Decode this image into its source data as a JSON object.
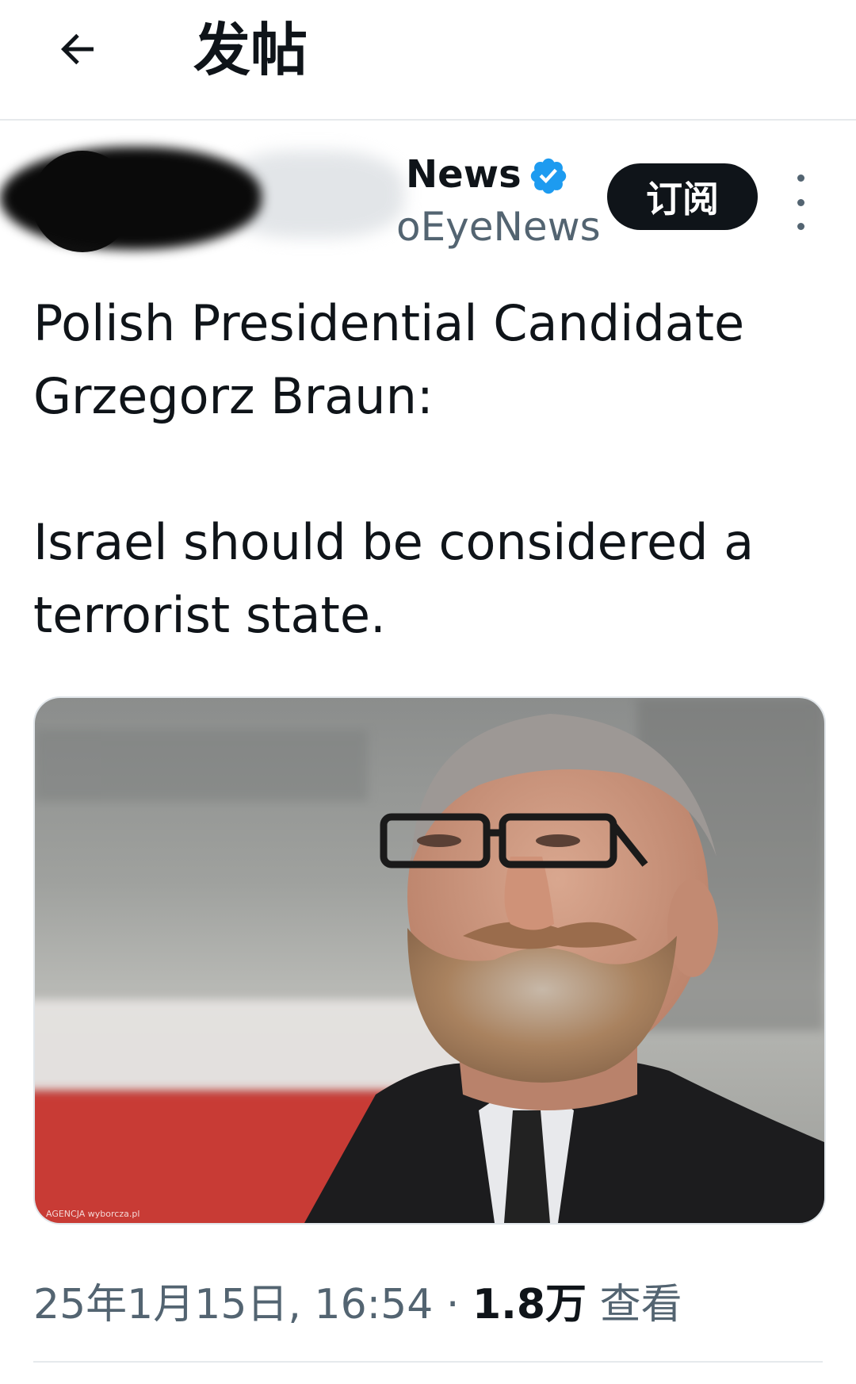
{
  "header": {
    "title": "发帖"
  },
  "author": {
    "display_name": "News",
    "handle": "oEyeNews",
    "subscribe_label": "订阅",
    "verified_color": "#1d9bf0"
  },
  "post": {
    "lines": [
      "Polish Presidential Candidate",
      "Grzegorz Braun:",
      "Israel should be considered a",
      "terrorist state."
    ],
    "image_watermark": "AGENCJA wyborcza.pl"
  },
  "meta": {
    "timestamp": "25年1月15日, 16:54",
    "separator": "·",
    "views_count": "1.8万",
    "views_label": "查看"
  },
  "icons": {
    "back": "arrow-left-icon",
    "verified": "verified-badge-icon",
    "more": "more-vertical-icon"
  }
}
